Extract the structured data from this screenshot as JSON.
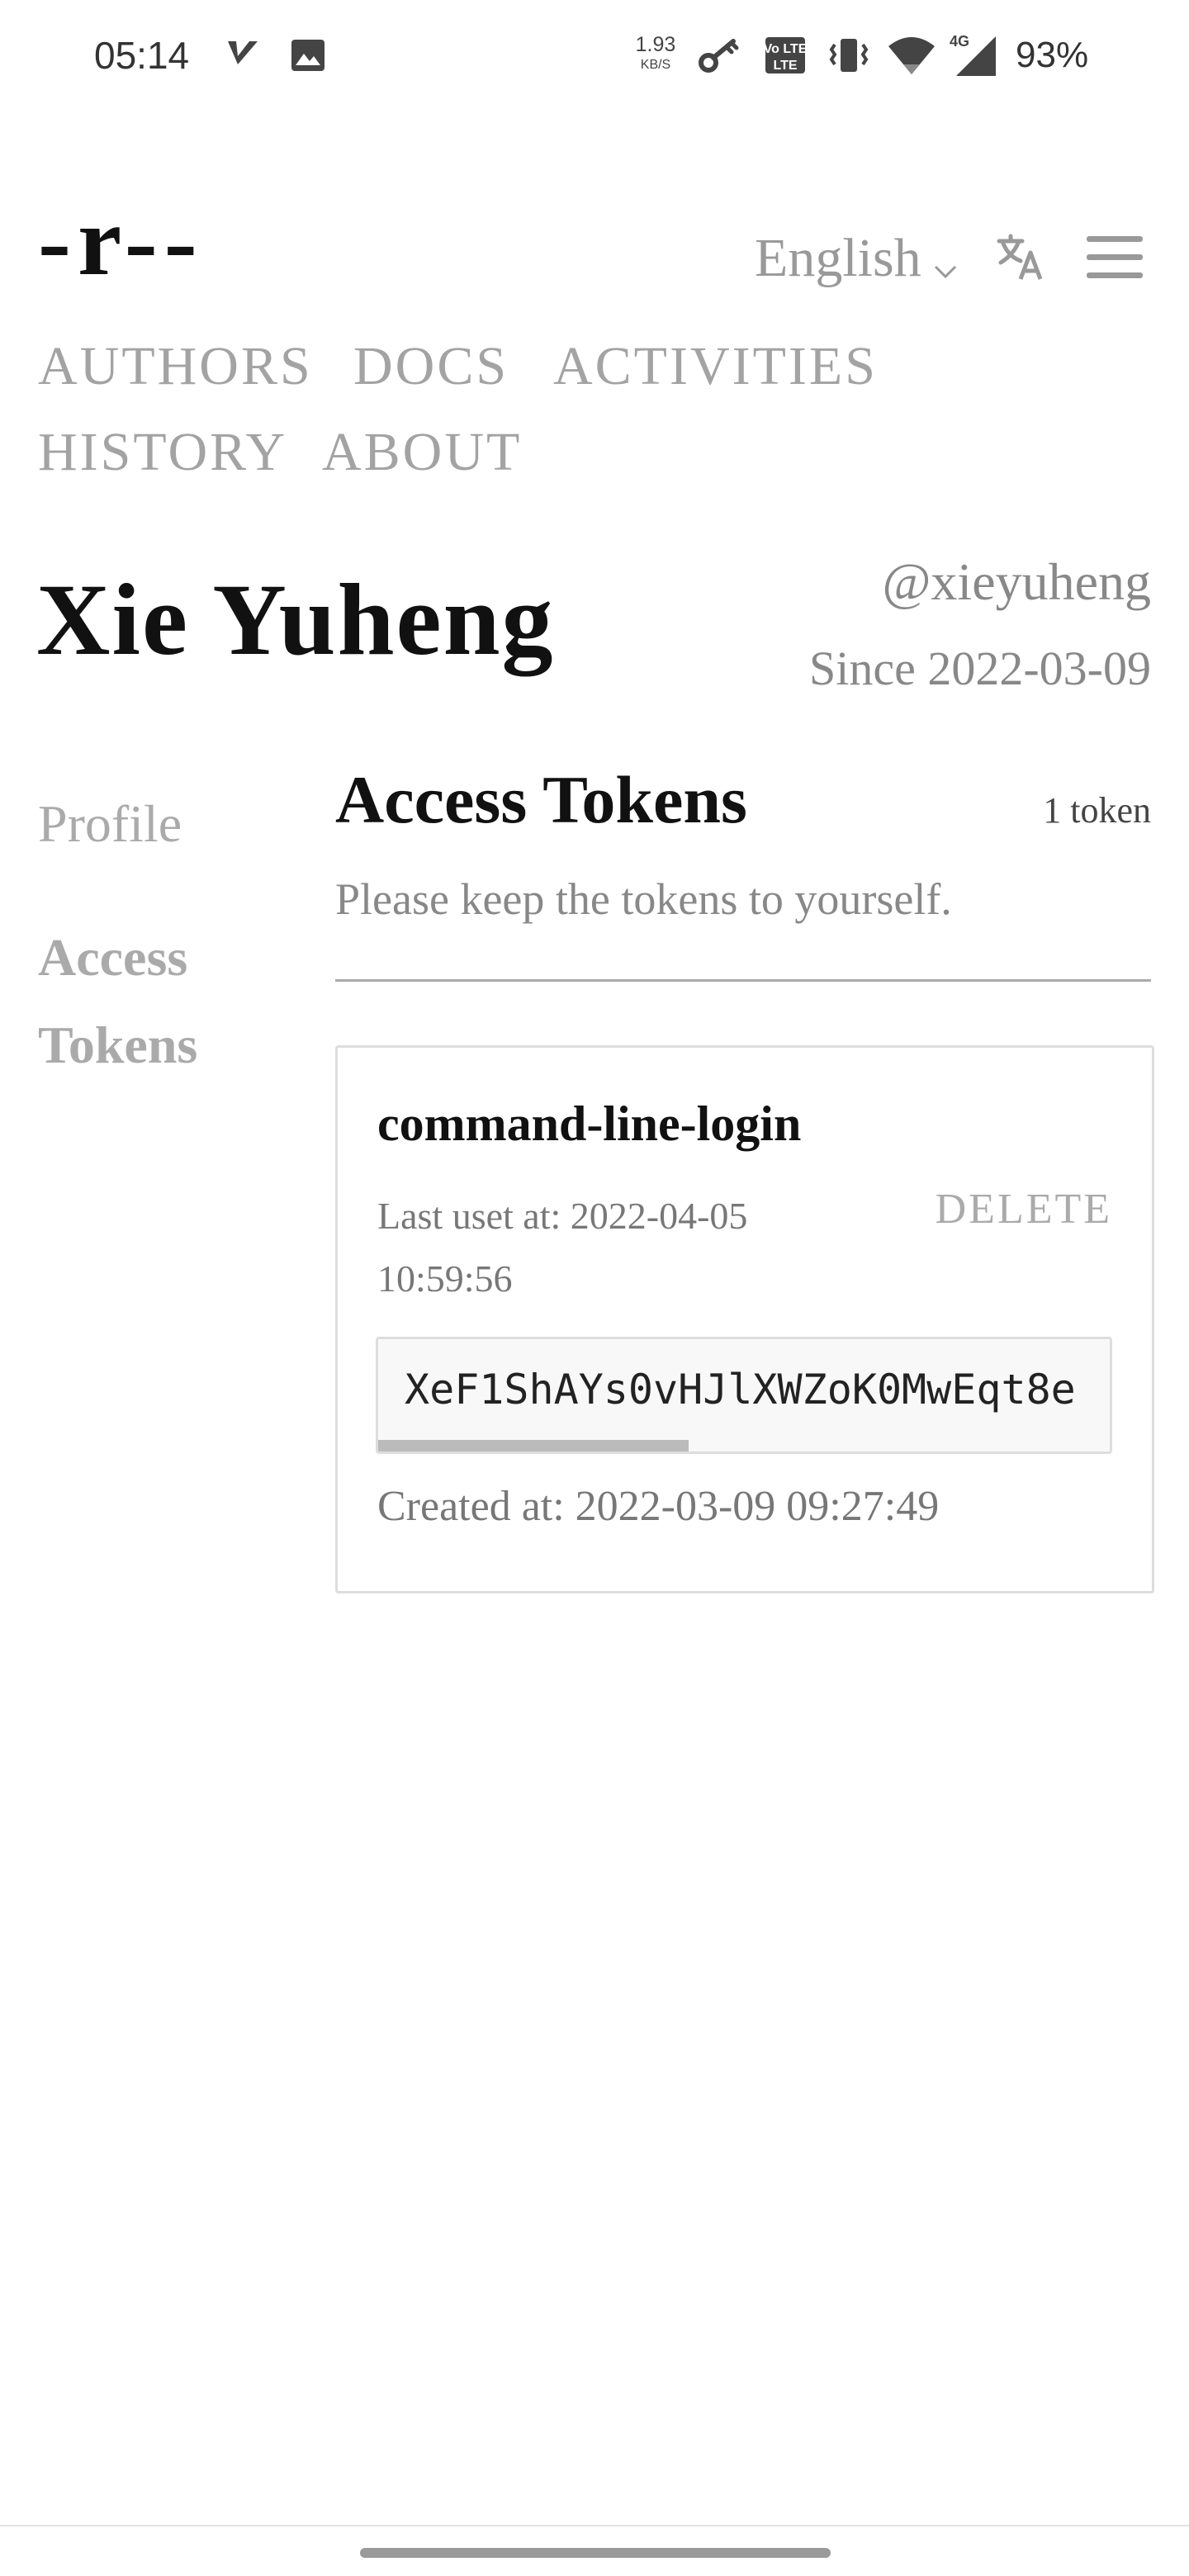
{
  "status_bar": {
    "time": "05:14",
    "net_speed": {
      "value": "1.93",
      "unit": "KB/S"
    },
    "network_type": "4G",
    "battery": "93%",
    "volte_label": "Vo LTE",
    "icons": [
      "v-notification-icon",
      "image-icon",
      "key-icon",
      "volte-icon",
      "vibrate-icon",
      "wifi-icon",
      "signal-icon"
    ]
  },
  "header": {
    "logo": "-r--",
    "language": "English",
    "icons": [
      "chevron-down-icon",
      "translate-icon",
      "menu-icon"
    ]
  },
  "nav": {
    "items": [
      "AUTHORS",
      "DOCS",
      "ACTIVITIES",
      "HISTORY",
      "ABOUT"
    ]
  },
  "user": {
    "name": "Xie Yuheng",
    "handle": "@xieyuheng",
    "since": "Since 2022-03-09"
  },
  "side_menu": {
    "items": [
      "Profile",
      "Access Tokens"
    ],
    "active": "Access Tokens"
  },
  "tokens_section": {
    "title": "Access Tokens",
    "count": "1 token",
    "hint": "Please keep the tokens to yourself."
  },
  "tokens": [
    {
      "name": "command-line-login",
      "last_used": "Last uset at: 2022-04-05 10:59:56",
      "delete_label": "DELETE",
      "value": "XeF1ShAYs0vHJlXWZoK0MwEqt8e",
      "scroll_position": 0.0,
      "created": "Created at: 2022-03-09 09:27:49"
    }
  ],
  "colors": {
    "text": "#111111",
    "muted": "#888888",
    "nav": "#a3a3a3",
    "border": "#dddddd",
    "background": "#ffffff"
  }
}
